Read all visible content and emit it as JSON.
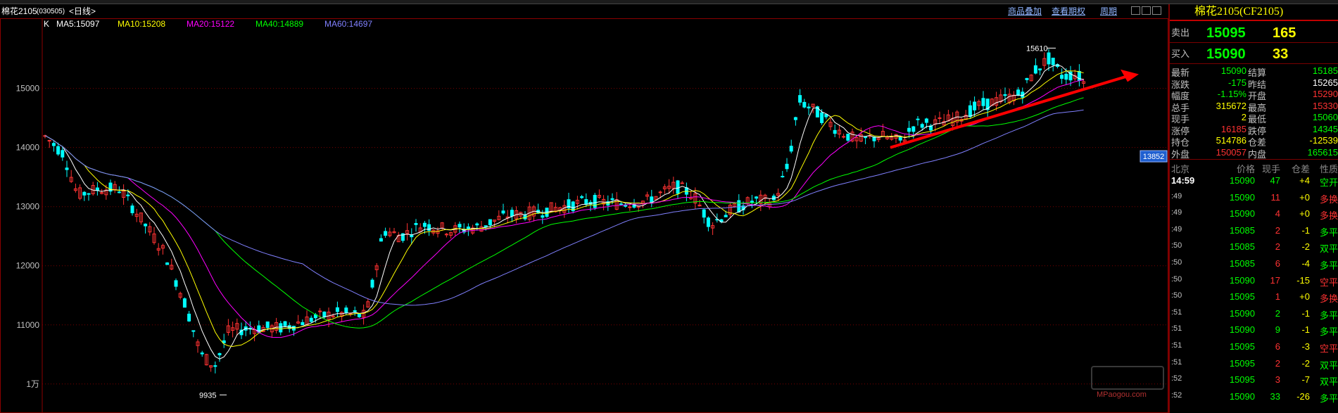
{
  "window": {
    "title": "棉花2105",
    "code": "(030505)",
    "period": "<日线>"
  },
  "toolbar": {
    "overlay_label": "商品叠加",
    "options_label": "查看期权",
    "cycle_label": "周期"
  },
  "ma_legend": {
    "type_label": "K",
    "items": [
      {
        "label": "MA5:15097",
        "color": "#ffffff"
      },
      {
        "label": "MA10:15208",
        "color": "#ffff00"
      },
      {
        "label": "MA20:15122",
        "color": "#ff00ff"
      },
      {
        "label": "MA40:14889",
        "color": "#00ff00"
      },
      {
        "label": "MA60:14697",
        "color": "#8080ff"
      }
    ]
  },
  "chart_data": {
    "type": "candlestick",
    "y_ticks": [
      "15000",
      "14000",
      "13000",
      "12000",
      "11000",
      "1万"
    ],
    "ylim": [
      9700,
      15900
    ],
    "high_label": "15610",
    "low_label": "9935",
    "cursor_price": "13852",
    "colors": {
      "up": "#ff3232",
      "down": "#00ffff",
      "ma5": "#ffffff",
      "ma10": "#ffff00",
      "ma20": "#ff00ff",
      "ma40": "#00ff00",
      "ma60": "#8080ff",
      "arrow": "#ff0000"
    }
  },
  "quote": {
    "title": "棉花2105(CF2105)",
    "sell": {
      "label": "卖出",
      "price": "15095",
      "volume": "165"
    },
    "buy": {
      "label": "买入",
      "price": "15090",
      "volume": "33"
    },
    "stats": [
      {
        "l1": "最新",
        "v1": "15090",
        "c1": "#00ff00",
        "l2": "结算",
        "v2": "15185",
        "c2": "#00ff00"
      },
      {
        "l1": "涨跌",
        "v1": "-175",
        "c1": "#00ff00",
        "l2": "昨结",
        "v2": "15265",
        "c2": "#ffffff"
      },
      {
        "l1": "幅度",
        "v1": "-1.15%",
        "c1": "#00ff00",
        "l2": "开盘",
        "v2": "15290",
        "c2": "#ff3232"
      },
      {
        "l1": "总手",
        "v1": "315672",
        "c1": "#ffff00",
        "l2": "最高",
        "v2": "15330",
        "c2": "#ff3232"
      },
      {
        "l1": "现手",
        "v1": "2",
        "c1": "#ffff00",
        "l2": "最低",
        "v2": "15060",
        "c2": "#00ff00"
      },
      {
        "l1": "涨停",
        "v1": "16185",
        "c1": "#ff3232",
        "l2": "跌停",
        "v2": "14345",
        "c2": "#00ff00"
      },
      {
        "l1": "持仓",
        "v1": "514786",
        "c1": "#ffff00",
        "l2": "仓差",
        "v2": "-12539",
        "c2": "#ffff00"
      },
      {
        "l1": "外盘",
        "v1": "150057",
        "c1": "#ff3232",
        "l2": "内盘",
        "v2": "165615",
        "c2": "#00ff00"
      }
    ],
    "ticks_header": {
      "time": "北京",
      "price": "价格",
      "vol": "现手",
      "oi": "仓差",
      "nature": "性质"
    },
    "ticks": [
      {
        "time": "14:59",
        "price": "15090",
        "vol": "47",
        "oi": "+4",
        "nature": "空开",
        "nc": "#00ff00"
      },
      {
        "time": ":49",
        "price": "15090",
        "vol": "11",
        "oi": "+0",
        "nature": "多换",
        "nc": "#ff3232"
      },
      {
        "time": ":49",
        "price": "15090",
        "vol": "4",
        "oi": "+0",
        "nature": "多换",
        "nc": "#ff3232"
      },
      {
        "time": ":49",
        "price": "15085",
        "vol": "2",
        "oi": "-1",
        "nature": "多平",
        "nc": "#00ff00"
      },
      {
        "time": ":50",
        "price": "15085",
        "vol": "2",
        "oi": "-2",
        "nature": "双平",
        "nc": "#00ff00"
      },
      {
        "time": ":50",
        "price": "15085",
        "vol": "6",
        "oi": "-4",
        "nature": "多平",
        "nc": "#00ff00"
      },
      {
        "time": ":50",
        "price": "15090",
        "vol": "17",
        "oi": "-15",
        "nature": "空平",
        "nc": "#ff3232"
      },
      {
        "time": ":50",
        "price": "15095",
        "vol": "1",
        "oi": "+0",
        "nature": "多换",
        "nc": "#ff3232"
      },
      {
        "time": ":51",
        "price": "15090",
        "vol": "2",
        "oi": "-1",
        "nature": "多平",
        "nc": "#00ff00"
      },
      {
        "time": ":51",
        "price": "15090",
        "vol": "9",
        "oi": "-1",
        "nature": "多平",
        "nc": "#00ff00"
      },
      {
        "time": ":51",
        "price": "15095",
        "vol": "6",
        "oi": "-3",
        "nature": "空平",
        "nc": "#ff3232"
      },
      {
        "time": ":51",
        "price": "15095",
        "vol": "2",
        "oi": "-2",
        "nature": "双平",
        "nc": "#00ff00"
      },
      {
        "time": ":52",
        "price": "15095",
        "vol": "3",
        "oi": "-7",
        "nature": "双平",
        "nc": "#00ff00"
      },
      {
        "time": ":52",
        "price": "15090",
        "vol": "33",
        "oi": "-26",
        "nature": "多平",
        "nc": "#00ff00"
      }
    ]
  },
  "watermark": {
    "text": "MPaogou.com"
  }
}
